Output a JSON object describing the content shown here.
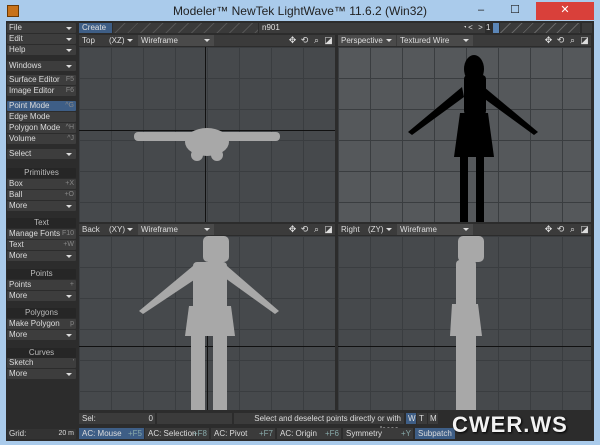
{
  "window": {
    "title": "Modeler™ NewTek LightWave™ 11.6.2 (Win32)",
    "minimize": "–",
    "maximize": "☐",
    "close": "✕"
  },
  "toolbar": {
    "create_tab": "Create",
    "object_name": "n901",
    "layer_number": "1",
    "prev": "<",
    "next": ">"
  },
  "sidebar": [
    {
      "label": "File",
      "dropdown": true
    },
    {
      "label": "Edit",
      "dropdown": true
    },
    {
      "label": "Help",
      "dropdown": true
    },
    {
      "label": "Windows",
      "dropdown": true
    },
    {
      "label": "Surface Editor",
      "shortcut": "F5"
    },
    {
      "label": "Image Editor",
      "shortcut": "F6"
    },
    {
      "label": "Point Mode",
      "shortcut": "^G",
      "selected": true
    },
    {
      "label": "Edge Mode"
    },
    {
      "label": "Polygon Mode",
      "shortcut": "^H"
    },
    {
      "label": "Volume",
      "shortcut": "^J"
    },
    {
      "label": "Select",
      "dropdown": true
    },
    {
      "label": "Primitives",
      "header": true
    },
    {
      "label": "Box",
      "shortcut": "+X"
    },
    {
      "label": "Ball",
      "shortcut": "+O"
    },
    {
      "label": "More",
      "dropdown": true
    },
    {
      "label": "Text",
      "header": true
    },
    {
      "label": "Manage Fonts",
      "shortcut": "F10"
    },
    {
      "label": "Text",
      "shortcut": "+W"
    },
    {
      "label": "More",
      "dropdown": true
    },
    {
      "label": "Points",
      "header": true
    },
    {
      "label": "Points",
      "shortcut": "+"
    },
    {
      "label": "More",
      "dropdown": true
    },
    {
      "label": "Polygons",
      "header": true
    },
    {
      "label": "Make Polygon",
      "shortcut": "p"
    },
    {
      "label": "More",
      "dropdown": true
    },
    {
      "label": "Curves",
      "header": true
    },
    {
      "label": "Sketch",
      "shortcut": "'"
    },
    {
      "label": "More",
      "dropdown": true
    }
  ],
  "grid": {
    "label": "Grid:",
    "value": "20 m"
  },
  "viewports": [
    {
      "view": "Top",
      "axes": "(XZ)",
      "mode": "Wireframe"
    },
    {
      "view": "Perspective",
      "axes": "",
      "mode": "Textured Wire"
    },
    {
      "view": "Back",
      "axes": "(XY)",
      "mode": "Wireframe"
    },
    {
      "view": "Right",
      "axes": "(ZY)",
      "mode": "Wireframe"
    }
  ],
  "status": {
    "sel_label": "Sel:",
    "sel_value": "0",
    "message": "Select and deselect points directly or with lasso.",
    "wtm": [
      "W",
      "T",
      "M"
    ]
  },
  "bottom_buttons": [
    {
      "label": "AC: Mouse",
      "shortcut": "+F5",
      "active": true
    },
    {
      "label": "AC: Selection",
      "shortcut": "+F8"
    },
    {
      "label": "AC: Pivot",
      "shortcut": "+F7"
    },
    {
      "label": "AC: Origin",
      "shortcut": "+F6"
    },
    {
      "label": "Symmetry",
      "shortcut": "+Y"
    },
    {
      "label": "Subpatch",
      "shortcut": "",
      "active": true
    }
  ],
  "watermark": "CWER.WS",
  "colors": {
    "accent": "#3e5e86",
    "viewport": "#46494c",
    "mesh": "#a8a8a8"
  }
}
